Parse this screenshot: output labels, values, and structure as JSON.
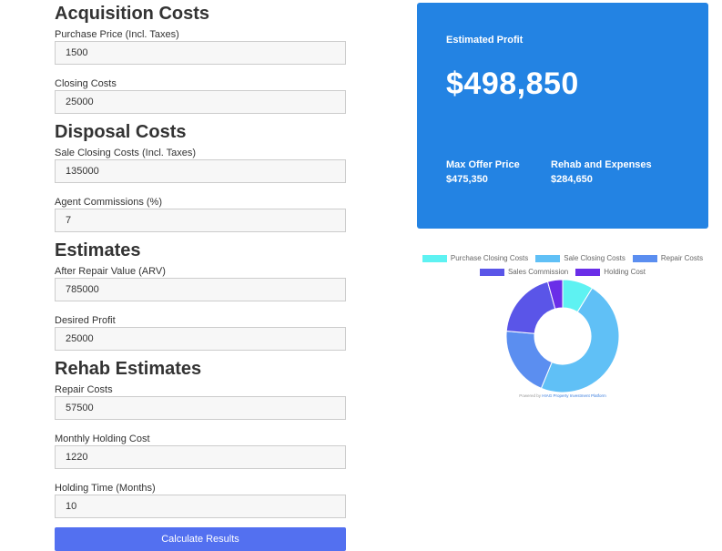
{
  "sections": {
    "acquisition": {
      "title": "Acquisition Costs",
      "purchase_price": {
        "label": "Purchase Price (Incl. Taxes)",
        "value": "1500"
      },
      "closing_costs": {
        "label": "Closing Costs",
        "value": "25000"
      }
    },
    "disposal": {
      "title": "Disposal Costs",
      "sale_closing_costs": {
        "label": "Sale Closing Costs (Incl. Taxes)",
        "value": "135000"
      },
      "agent_commissions": {
        "label": "Agent Commissions (%)",
        "value": "7"
      }
    },
    "estimates": {
      "title": "Estimates",
      "arv": {
        "label": "After Repair Value (ARV)",
        "value": "785000"
      },
      "desired_profit": {
        "label": "Desired Profit",
        "value": "25000"
      }
    },
    "rehab": {
      "title": "Rehab Estimates",
      "repair_costs": {
        "label": "Repair Costs",
        "value": "57500"
      },
      "monthly_holding_cost": {
        "label": "Monthly Holding Cost",
        "value": "1220"
      },
      "holding_time": {
        "label": "Holding Time (Months)",
        "value": "10"
      }
    }
  },
  "calculate_button": "Calculate Results",
  "results": {
    "estimated_profit_label": "Estimated Profit",
    "estimated_profit_value": "$498,850",
    "max_offer_label": "Max Offer Price",
    "max_offer_value": "$475,350",
    "rehab_label": "Rehab and Expenses",
    "rehab_value": "$284,650",
    "card_color": "#2383e3"
  },
  "footer": {
    "powered_prefix": "Powered by",
    "powered_link": "HIAG Property Investment Platform"
  },
  "chart_data": {
    "type": "doughnut",
    "legend_position": "top",
    "categories": [
      "Purchase Closing Costs",
      "Sale Closing Costs",
      "Repair Costs",
      "Sales Commission",
      "Holding Cost"
    ],
    "values": [
      25000,
      135000,
      57500,
      54950,
      12200
    ],
    "colors": [
      "#5ef2f2",
      "#60c0f6",
      "#5b8ef0",
      "#5a55e8",
      "#6a2ee8"
    ]
  }
}
